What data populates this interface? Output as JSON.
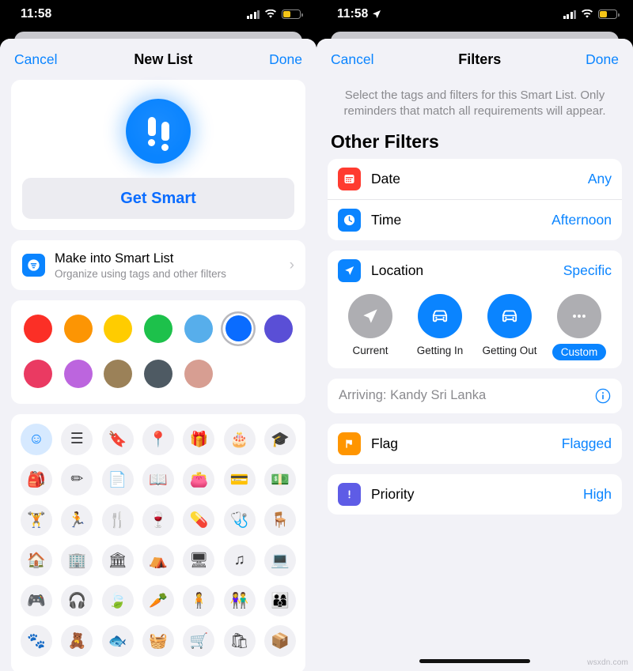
{
  "left": {
    "status": {
      "time": "11:58",
      "has_location_arrow": false
    },
    "nav": {
      "cancel": "Cancel",
      "title": "New List",
      "done": "Done"
    },
    "smart": {
      "button": "Get Smart",
      "glyph": "double-exclamation"
    },
    "make_smart": {
      "title": "Make into Smart List",
      "subtitle": "Organize using tags and other filters",
      "chevron": "›"
    },
    "colors": {
      "row1": [
        {
          "name": "red",
          "hex": "#FB2F26",
          "selected": false
        },
        {
          "name": "orange",
          "hex": "#FC9504",
          "selected": false
        },
        {
          "name": "yellow",
          "hex": "#FFCC00",
          "selected": false
        },
        {
          "name": "green",
          "hex": "#1DC14B",
          "selected": false
        },
        {
          "name": "light-blue",
          "hex": "#57AEEB",
          "selected": false
        },
        {
          "name": "blue",
          "hex": "#0A6CFF",
          "selected": true
        },
        {
          "name": "indigo",
          "hex": "#5A4FD6",
          "selected": false
        }
      ],
      "row2": [
        {
          "name": "pink",
          "hex": "#EA3A62",
          "selected": false
        },
        {
          "name": "purple",
          "hex": "#BC65DE",
          "selected": false
        },
        {
          "name": "brown",
          "hex": "#9B8158",
          "selected": false
        },
        {
          "name": "slate",
          "hex": "#4E5A63",
          "selected": false
        },
        {
          "name": "salmon",
          "hex": "#D79E92",
          "selected": false
        }
      ]
    },
    "icon_grid": [
      [
        "smiley-face",
        "bulleted-list",
        "bookmark",
        "map-pin",
        "gift",
        "birthday-cake",
        "graduation-cap"
      ],
      [
        "backpack",
        "pencil-ruler",
        "document",
        "open-book",
        "wallet",
        "credit-card",
        "money"
      ],
      [
        "dumbbell",
        "running-person",
        "fork-knife",
        "wine-glass",
        "pills",
        "stethoscope",
        "bench"
      ],
      [
        "house",
        "office-building",
        "bank",
        "tent",
        "monitor",
        "music-note",
        "laptop"
      ],
      [
        "game-controller",
        "headphones",
        "leaf",
        "carrot",
        "person",
        "two-people",
        "three-people"
      ],
      [
        "paw-print",
        "teddy-bear",
        "fish",
        "shopping-basket",
        "shopping-cart",
        "shopping-bag",
        "package"
      ]
    ],
    "icon_glyphs": [
      [
        "☺",
        "☰",
        "🔖",
        "📍",
        "🎁",
        "🎂",
        "🎓"
      ],
      [
        "🎒",
        "✏",
        "📄",
        "📖",
        "👛",
        "💳",
        "💵"
      ],
      [
        "🏋",
        "🏃",
        "🍴",
        "🍷",
        "💊",
        "🩺",
        "🪑"
      ],
      [
        "🏠",
        "🏢",
        "🏛",
        "⛺",
        "🖥",
        "♫",
        "💻"
      ],
      [
        "🎮",
        "🎧",
        "🍃",
        "🥕",
        "🧍",
        "👫",
        "👨‍👩‍👦"
      ],
      [
        "🐾",
        "🧸",
        "🐟",
        "🧺",
        "🛒",
        "🛍",
        "📦"
      ]
    ],
    "selected_icon_index": 0
  },
  "right": {
    "status": {
      "time": "11:58",
      "has_location_arrow": true
    },
    "nav": {
      "cancel": "Cancel",
      "title": "Filters",
      "done": "Done"
    },
    "description": "Select the tags and filters for this Smart List. Only reminders that match all requirements will appear.",
    "section_title": "Other Filters",
    "rows": [
      {
        "icon": "calendar-icon",
        "icon_color": "red",
        "label": "Date",
        "value": "Any"
      },
      {
        "icon": "clock-icon",
        "icon_color": "blue",
        "label": "Time",
        "value": "Afternoon"
      }
    ],
    "location": {
      "icon": "location-arrow-icon",
      "label": "Location",
      "value": "Specific",
      "options": [
        {
          "name": "current",
          "caption": "Current",
          "glyph": "navigation-arrow-icon",
          "active": false,
          "caption_pill": false
        },
        {
          "name": "getting-in",
          "caption": "Getting In",
          "glyph": "car-icon",
          "active": true,
          "caption_pill": false
        },
        {
          "name": "getting-out",
          "caption": "Getting Out",
          "glyph": "car-icon",
          "active": true,
          "caption_pill": false
        },
        {
          "name": "custom",
          "caption": "Custom",
          "glyph": "ellipsis-icon",
          "active": false,
          "caption_pill": true
        }
      ],
      "arriving_text": "Arriving: Kandy Sri Lanka",
      "info_icon": "info-circle-icon"
    },
    "flag": {
      "icon": "flag-icon",
      "icon_color": "orange",
      "label": "Flag",
      "value": "Flagged"
    },
    "priority": {
      "icon": "priority-icon",
      "icon_color": "purple",
      "label": "Priority",
      "value": "High"
    }
  },
  "watermark": "wsxdn.com",
  "accent": "#0A84FF"
}
